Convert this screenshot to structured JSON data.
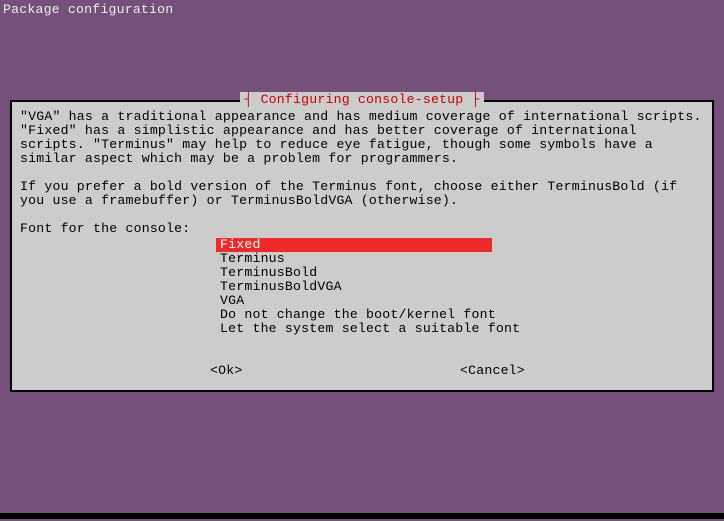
{
  "header": {
    "title": "Package configuration"
  },
  "dialog": {
    "title_decor_left": "┤ ",
    "title": "Configuring console-setup",
    "title_decor_right": " ├",
    "paragraph1": "\"VGA\" has a traditional appearance and has medium coverage of international scripts. \"Fixed\" has a simplistic appearance and has better coverage of international scripts. \"Terminus\" may help to reduce eye fatigue, though some symbols have a similar aspect which may be a problem for programmers.",
    "paragraph2": "If you prefer a bold version of the Terminus font, choose either TerminusBold (if you use a framebuffer) or TerminusBoldVGA (otherwise).",
    "prompt": "Font for the console:",
    "options": [
      "Fixed",
      "Terminus",
      "TerminusBold",
      "TerminusBoldVGA",
      "VGA",
      "Do not change the boot/kernel font",
      "Let the system select a suitable font"
    ],
    "selected_index": 0,
    "ok_label": "<Ok>",
    "cancel_label": "<Cancel>"
  },
  "colors": {
    "desktop": "#75507b",
    "panel": "#cccccc",
    "title": "#cc0000",
    "highlight_bg": "#ef2929",
    "highlight_fg": "#ffffff"
  }
}
